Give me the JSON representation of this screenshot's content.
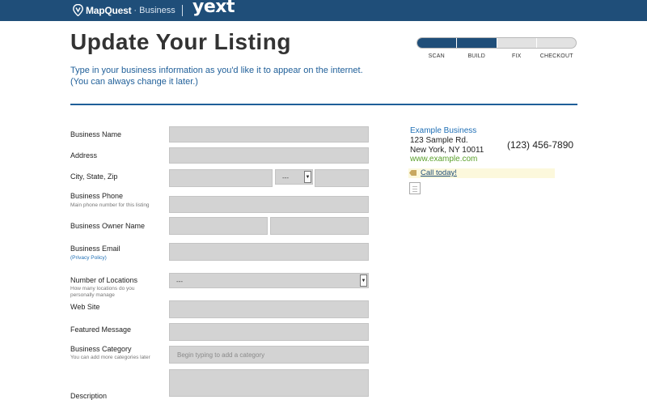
{
  "header": {
    "brand_name": "MapQuest",
    "brand_suffix": "Business",
    "partner": "yext",
    "colors": {
      "bar": "#1f4e79",
      "accent_blue": "#1f5f99",
      "link_green": "#5aa02c"
    }
  },
  "page": {
    "title": "Update Your Listing",
    "intro_line1": "Type in your business information as you'd like it to appear on the internet.",
    "intro_line2": "(You can always change it later.)"
  },
  "progress": {
    "steps": [
      "SCAN",
      "BUILD",
      "FIX",
      "CHECKOUT"
    ],
    "completed_steps": 2
  },
  "form": {
    "business_name": {
      "label": "Business Name",
      "value": ""
    },
    "address": {
      "label": "Address",
      "value": ""
    },
    "city_state_zip": {
      "label": "City, State, Zip",
      "state_value": "---"
    },
    "business_phone": {
      "label": "Business Phone",
      "hint": "Main phone number for this listing"
    },
    "owner_name": {
      "label": "Business Owner Name"
    },
    "business_email": {
      "label": "Business Email",
      "link": "(Privacy Policy)"
    },
    "locations": {
      "label": "Number of Locations",
      "hint_line1": "How many locations do you",
      "hint_line2": "personally manage",
      "value": "---"
    },
    "website": {
      "label": "Web Site"
    },
    "featured_message": {
      "label": "Featured Message"
    },
    "category": {
      "label": "Business Category",
      "hint": "You can add more categories later",
      "placeholder": "Begin typing to add a category"
    },
    "description": {
      "label": "Description"
    }
  },
  "preview": {
    "name": "Example Business",
    "address1": "123 Sample Rd.",
    "address2": "New York, NY 10011",
    "website": "www.example.com",
    "phone": "(123) 456-7890",
    "cta": "Call today!"
  }
}
